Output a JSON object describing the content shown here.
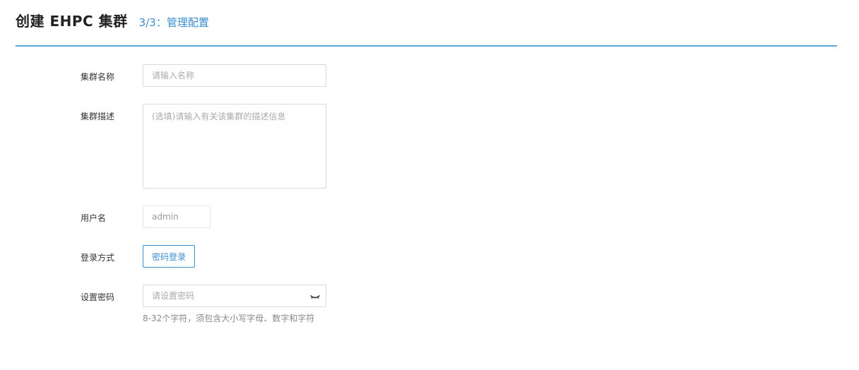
{
  "header": {
    "title": "创建 EHPC 集群",
    "step": "3/3：管理配置"
  },
  "form": {
    "cluster_name": {
      "label": "集群名称",
      "placeholder": "请输入名称",
      "value": ""
    },
    "cluster_desc": {
      "label": "集群描述",
      "placeholder": "(选填)请输入有关该集群的描述信息",
      "value": ""
    },
    "username": {
      "label": "用户名",
      "value": "admin"
    },
    "login_method": {
      "label": "登录方式",
      "option": "密码登录"
    },
    "password": {
      "label": "设置密码",
      "placeholder": "请设置密码",
      "value": "",
      "hint": "8-32个字符，须包含大小写字母、数字和字符",
      "toggle_icon": "eye-closed-icon"
    }
  },
  "colors": {
    "accent": "#3a8ed0",
    "divider": "#5aa6dc"
  }
}
